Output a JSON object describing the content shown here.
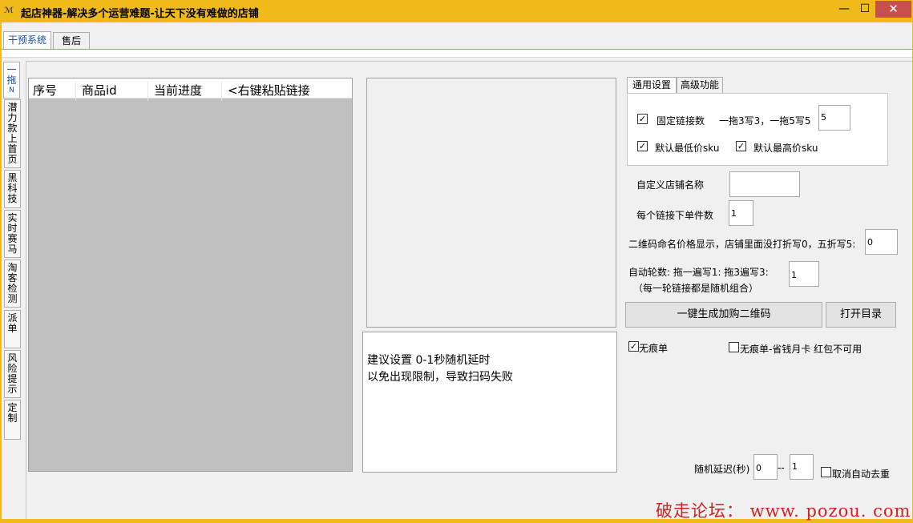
{
  "window": {
    "title": "起店神器-解决多个运营难题-让天下没有难做的店铺",
    "icon_text": "ℳ",
    "minimize": "—",
    "maximize": "☐",
    "close": "✕"
  },
  "top_tabs": [
    "干预系统",
    "售后"
  ],
  "side_tabs": [
    [
      "一",
      "拖",
      "N"
    ],
    [
      "潜",
      "力",
      "款",
      "上",
      "首",
      "页"
    ],
    [
      "黑",
      "科",
      "技"
    ],
    [
      "实",
      "时",
      "赛",
      "马"
    ],
    [
      "淘",
      "客",
      "检",
      "测"
    ],
    [
      "派",
      "单"
    ],
    [
      "风",
      "险",
      "提",
      "示"
    ],
    [
      "定",
      "制"
    ]
  ],
  "list": {
    "columns": [
      "序号",
      "商品id",
      "当前进度",
      "<右键粘贴链接"
    ]
  },
  "tip": {
    "line1": "建议设置  0-1秒随机延时",
    "line2": "以免出现限制，导致扫码失败"
  },
  "settings": {
    "tabs": [
      "通用设置",
      "高级功能"
    ],
    "fixed_links": {
      "label": "固定链接数",
      "checked": true,
      "hint": "一拖3写3，一拖5写5",
      "value": "5"
    },
    "default_low_sku": {
      "label": "默认最低价sku",
      "checked": true
    },
    "default_high_sku": {
      "label": "默认最高价sku",
      "checked": true
    },
    "custom_shop_name": {
      "label": "自定义店铺名称",
      "value": ""
    },
    "qty_per_link": {
      "label": "每个链接下单件数",
      "value": "1"
    },
    "qr_price": {
      "label": "二维码命名价格显示，店铺里面没打折写0，五折写5:",
      "value": "0"
    },
    "auto_rounds": {
      "label": "自动轮数: 拖一遍写1: 拖3遍写3:",
      "note": "（每一轮链接都是随机组合）",
      "value": "1"
    },
    "gen_button": "一键生成加购二维码",
    "open_dir_button": "打开目录",
    "no_trace": {
      "label": "无痕单",
      "checked": true
    },
    "no_trace_card": {
      "label": "无痕单-省钱月卡 红包不可用",
      "checked": false
    },
    "random_delay": {
      "label": "随机延迟(秒)",
      "from": "0",
      "sep": "--",
      "to": "1"
    },
    "cancel_dedupe": {
      "label": "取消自动去重",
      "checked": false
    }
  },
  "watermark": "破走论坛： www. pozou. com"
}
